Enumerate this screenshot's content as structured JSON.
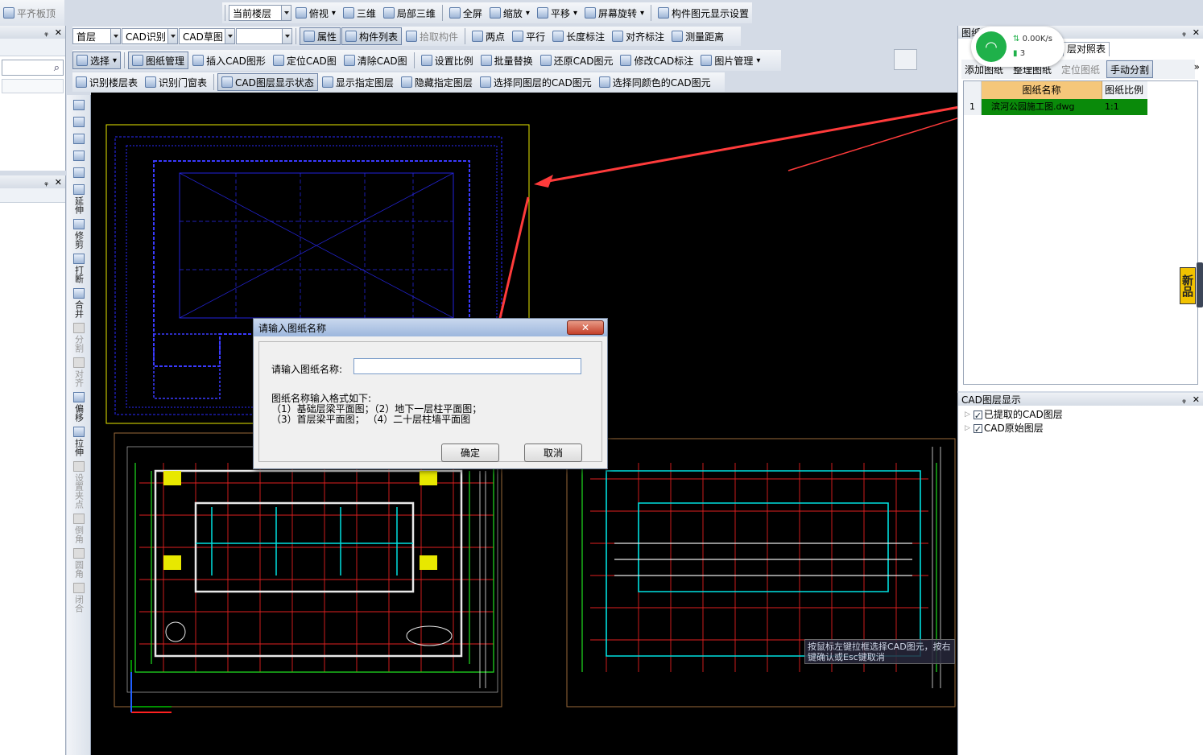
{
  "top_left": {
    "tab_label": "平齐板顶"
  },
  "toolbar1": {
    "floor_combo": "当前楼层",
    "view_top": "俯视",
    "view_3d": "三维",
    "view_local3d": "局部三维",
    "fullscreen": "全屏",
    "zoom": "缩放",
    "pan": "平移",
    "rotate": "屏幕旋转",
    "display_settings": "构件图元显示设置"
  },
  "toolbar2": {
    "floor": "首层",
    "cad_recognize": "CAD识别",
    "cad_draft": "CAD草图",
    "properties": "属性",
    "component_list": "构件列表",
    "pick_component": "拾取构件",
    "two_points": "两点",
    "parallel": "平行",
    "length_dim": "长度标注",
    "align_dim": "对齐标注",
    "measure_distance": "测量距离"
  },
  "toolbar3": {
    "select": "选择",
    "drawing_mgmt": "图纸管理",
    "insert_cad": "插入CAD图形",
    "locate_cad": "定位CAD图",
    "clear_cad": "清除CAD图",
    "set_scale": "设置比例",
    "batch_replace": "批量替换",
    "restore_cad": "还原CAD图元",
    "modify_cad_dim": "修改CAD标注",
    "image_mgmt": "图片管理"
  },
  "toolbar4": {
    "recognize_floor_table": "识别楼层表",
    "recognize_door_window": "识别门窗表",
    "cad_layer_display": "CAD图层显示状态",
    "show_layer": "显示指定图层",
    "hide_layer": "隐藏指定图层",
    "select_same_layer": "选择同图层的CAD图元",
    "select_same_color": "选择同颜色的CAD图元"
  },
  "vertical_tools": [
    "延伸",
    "修剪",
    "打断",
    "合并",
    "分割",
    "对齐",
    "偏移",
    "拉伸",
    "设置夹点",
    "倒角",
    "圆角",
    "闭合"
  ],
  "drawing_panel": {
    "title": "图纸",
    "tab_extra": "层对照表",
    "buttons": [
      "添加图纸",
      "整理图纸",
      "定位图纸",
      "手动分割"
    ],
    "columns": [
      "图纸名称",
      "图纸比例"
    ],
    "rows": [
      {
        "index": "1",
        "name": "滨河公园施工图.dwg",
        "scale": "1:1"
      }
    ]
  },
  "network_widget": {
    "speed": "0.00K/s",
    "count": "3"
  },
  "badge": {
    "text": "新品"
  },
  "layer_panel": {
    "title": "CAD图层显示",
    "items": [
      "已提取的CAD图层",
      "CAD原始图层"
    ]
  },
  "dialog": {
    "title": "请输入图纸名称",
    "label": "请输入图纸名称:",
    "input_value": "",
    "hint_title": "图纸名称输入格式如下:",
    "hint_line1": "（1）基础层梁平面图；（2）地下一层柱平面图；",
    "hint_line2": "（3）首层梁平面图；  （4）二十层柱墙平面图",
    "ok": "确定",
    "cancel": "取消"
  },
  "status_tip": "按鼠标左键拉框选择CAD图元，按右键确认或Esc键取消",
  "colors": {
    "annotation_arrow": "#ff3b3b",
    "highlight_row": "#0a8a0a",
    "header_row": "#f5c77a"
  }
}
